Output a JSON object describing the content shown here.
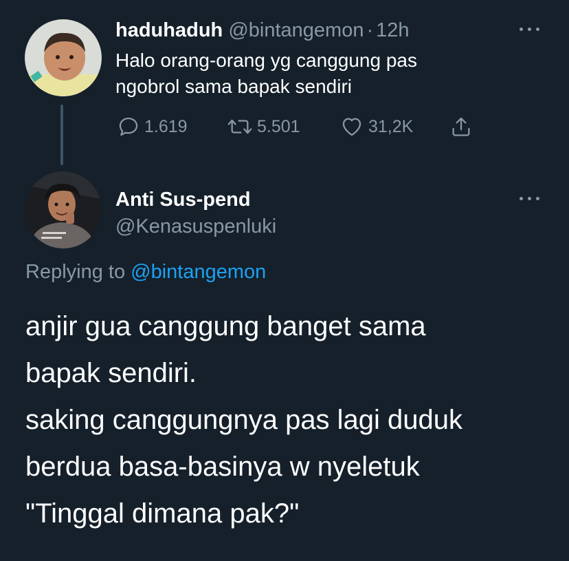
{
  "tweet": {
    "display_name": "haduhaduh",
    "handle": "@bintangemon",
    "separator": "·",
    "time": "12h",
    "text_lines": [
      "Halo orang-orang yg canggung pas",
      "ngobrol sama bapak sendiri"
    ],
    "stats": {
      "replies": "1.619",
      "retweets": "5.501",
      "likes": "31,2K"
    },
    "icons": {
      "reply": "reply-icon",
      "retweet": "retweet-icon",
      "like": "heart-icon",
      "share": "share-icon",
      "more": "more-icon"
    }
  },
  "reply": {
    "display_name": "Anti Sus-pend",
    "handle": "@Kenasuspenluki",
    "replying_to_prefix": "Replying to",
    "replying_to_handle": "@bintangemon",
    "text_lines": [
      "anjir gua canggung banget sama",
      "bapak sendiri.",
      "saking canggungnya pas lagi duduk",
      "berdua basa-basinya w nyeletuk",
      "\"Tinggal dimana pak?\""
    ]
  },
  "colors": {
    "background": "#15202b",
    "text": "#ffffff",
    "muted": "#8899a6",
    "link": "#1da1f2"
  }
}
